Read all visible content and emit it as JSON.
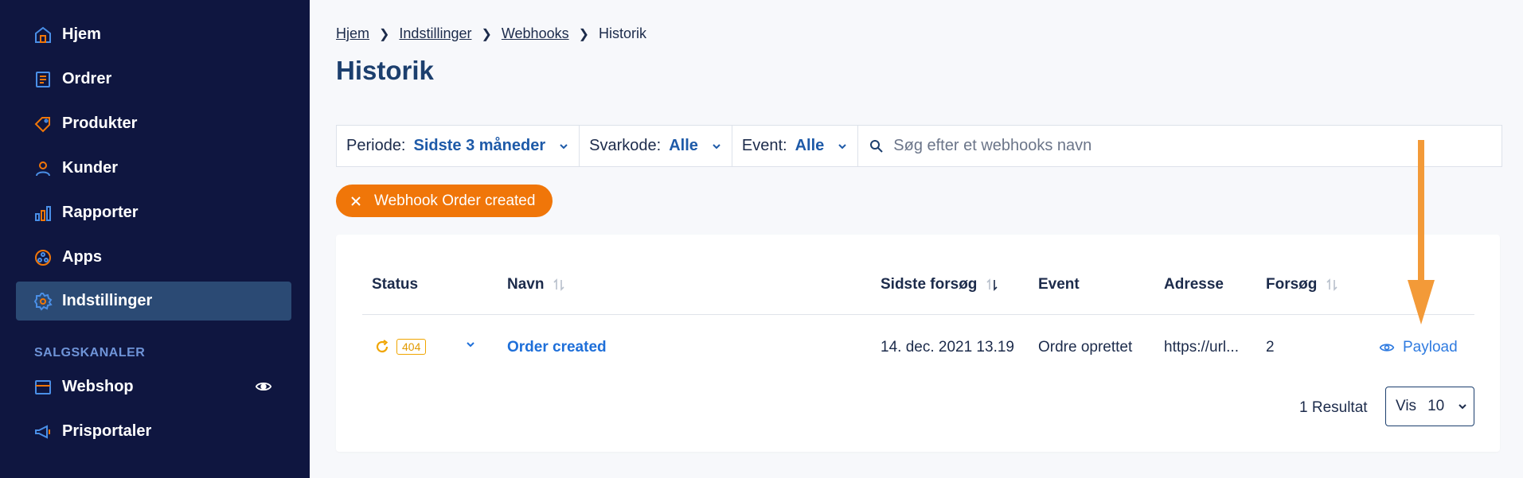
{
  "sidebar": {
    "items": [
      {
        "label": "Hjem",
        "icon": "home-icon"
      },
      {
        "label": "Ordrer",
        "icon": "orders-icon"
      },
      {
        "label": "Produkter",
        "icon": "tag-icon"
      },
      {
        "label": "Kunder",
        "icon": "user-icon"
      },
      {
        "label": "Rapporter",
        "icon": "bar-chart-icon"
      },
      {
        "label": "Apps",
        "icon": "apps-icon"
      },
      {
        "label": "Indstillinger",
        "icon": "gear-icon",
        "active": true
      }
    ],
    "section_label": "SALGSKANALER",
    "channels": [
      {
        "label": "Webshop",
        "icon": "store-icon",
        "trailing_icon": "eye-icon"
      },
      {
        "label": "Prisportaler",
        "icon": "megaphone-icon"
      }
    ]
  },
  "breadcrumb": [
    "Hjem",
    "Indstillinger",
    "Webhooks",
    "Historik"
  ],
  "page_title": "Historik",
  "filters": [
    {
      "label": "Periode:",
      "value": "Sidste 3 måneder"
    },
    {
      "label": "Svarkode:",
      "value": "Alle"
    },
    {
      "label": "Event:",
      "value": "Alle"
    }
  ],
  "search": {
    "placeholder": "Søg efter et webhooks navn",
    "value": ""
  },
  "active_filter_chip": "Webhook Order created",
  "table": {
    "columns": [
      "Status",
      "Navn",
      "Sidste forsøg",
      "Event",
      "Adresse",
      "Forsøg"
    ],
    "rows": [
      {
        "status_code": "404",
        "name": "Order created",
        "last_attempt": "14. dec. 2021 13.19",
        "event": "Ordre oprettet",
        "address": "https://url...",
        "attempts": "2",
        "action": "Payload"
      }
    ]
  },
  "pagination": {
    "results": "1 Resultat",
    "show_label": "Vis",
    "page_size": "10"
  },
  "colors": {
    "sidebar_bg": "#0f1640",
    "accent_orange": "#f07609",
    "link_blue": "#1e6fd9",
    "icon_orange": "#f07609",
    "icon_blue": "#4a8fe7"
  }
}
